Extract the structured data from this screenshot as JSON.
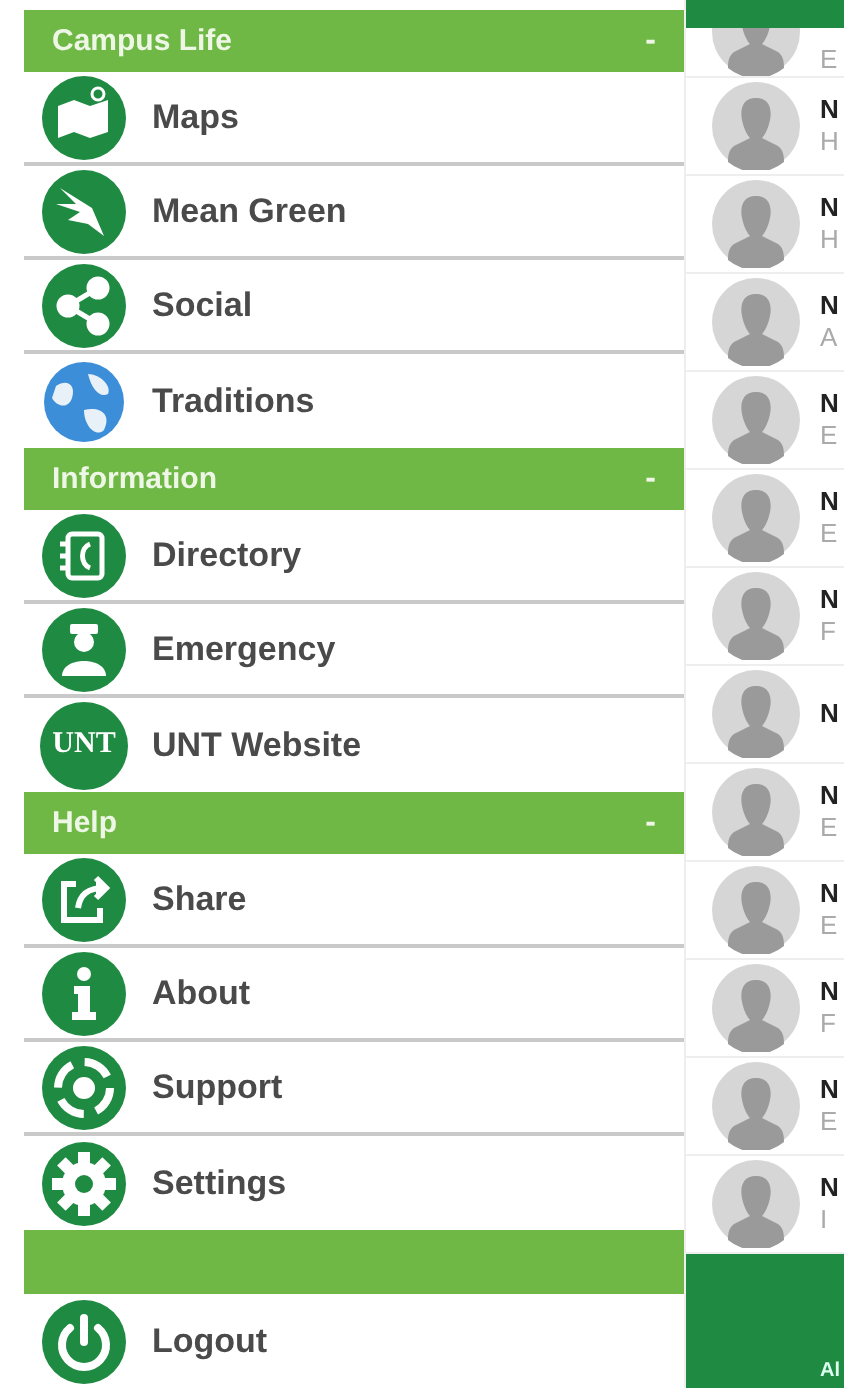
{
  "sections": [
    {
      "title": "Campus Life",
      "toggle": "-",
      "items": [
        {
          "label": "Maps"
        },
        {
          "label": "Mean Green"
        },
        {
          "label": "Social"
        },
        {
          "label": "Traditions"
        }
      ]
    },
    {
      "title": "Information",
      "toggle": "-",
      "items": [
        {
          "label": "Directory"
        },
        {
          "label": "Emergency"
        },
        {
          "label": "UNT Website",
          "badge": "UNT"
        }
      ]
    },
    {
      "title": "Help",
      "toggle": "-",
      "items": [
        {
          "label": "Share"
        },
        {
          "label": "About"
        },
        {
          "label": "Support"
        },
        {
          "label": "Settings"
        }
      ]
    }
  ],
  "logout": {
    "label": "Logout"
  },
  "background_list": {
    "rows": [
      {
        "name": "",
        "detail": "E"
      },
      {
        "name": "N",
        "detail": "H"
      },
      {
        "name": "N",
        "detail": "H"
      },
      {
        "name": "N",
        "detail": "A"
      },
      {
        "name": "N",
        "detail": "E"
      },
      {
        "name": "N",
        "detail": "E"
      },
      {
        "name": "N",
        "detail": "F"
      },
      {
        "name": "N",
        "detail": ""
      },
      {
        "name": "N",
        "detail": "E"
      },
      {
        "name": "N",
        "detail": "E"
      },
      {
        "name": "N",
        "detail": "F"
      },
      {
        "name": "N",
        "detail": "E"
      },
      {
        "name": "N",
        "detail": "I"
      }
    ],
    "button": {
      "label": "Al"
    }
  }
}
